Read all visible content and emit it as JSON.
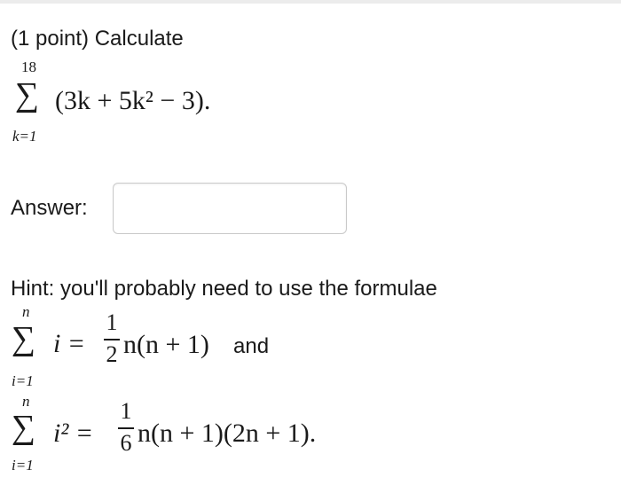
{
  "problem": {
    "prefix": "(1 point) Calculate",
    "sum_upper": "18",
    "sum_lower": "k=1",
    "sigma": "∑",
    "summand": "(3k + 5k² − 3)."
  },
  "answer": {
    "label": "Answer:",
    "value": "",
    "placeholder": ""
  },
  "hint": {
    "text": "Hint: you'll probably need to use the formulae",
    "formula1": {
      "sigma": "∑",
      "upper": "n",
      "lower": "i=1",
      "lhs": "i =",
      "frac_num": "1",
      "frac_den": "2",
      "rhs": "n(n + 1)",
      "connector": "and"
    },
    "formula2": {
      "sigma": "∑",
      "upper": "n",
      "lower": "i=1",
      "lhs": "i² =",
      "frac_num": "1",
      "frac_den": "6",
      "rhs": "n(n + 1)(2n + 1)."
    }
  }
}
